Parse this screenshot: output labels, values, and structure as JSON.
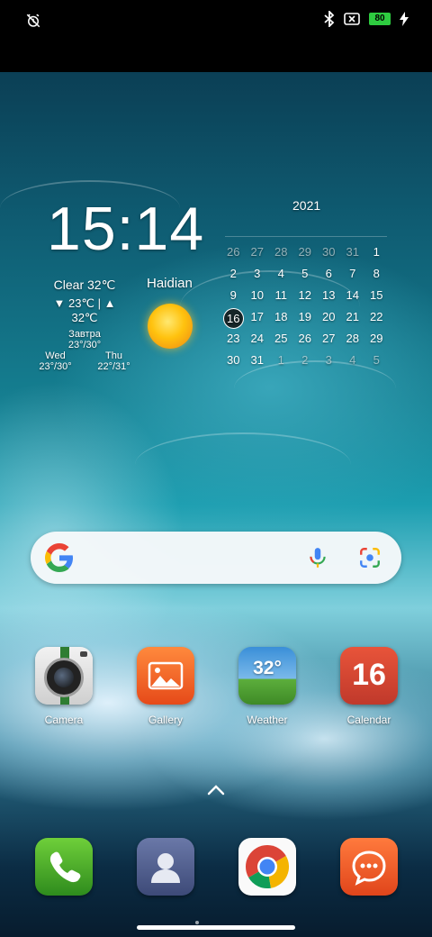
{
  "status_bar": {
    "battery_level": "80",
    "left_icon": "alarm-off-icon",
    "right_icons": [
      "bluetooth-icon",
      "sim-error-icon",
      "battery-icon",
      "charging-icon"
    ]
  },
  "clock_widget": {
    "time": "15:14",
    "weather": {
      "condition": "Clear 32℃",
      "range": "▼ 23℃ | ▲ 32℃",
      "tomorrow_label": "Завтра",
      "tomorrow_range": "23°/30°",
      "forecast": [
        {
          "day": "Wed",
          "range": "23°/30°"
        },
        {
          "day": "Thu",
          "range": "22°/31°"
        }
      ]
    },
    "city": "Haidian",
    "icon": "sun-icon"
  },
  "calendar_widget": {
    "year": "2021",
    "today": "16",
    "days": [
      {
        "d": "26",
        "dim": true
      },
      {
        "d": "27",
        "dim": true
      },
      {
        "d": "28",
        "dim": true
      },
      {
        "d": "29",
        "dim": true
      },
      {
        "d": "30",
        "dim": true
      },
      {
        "d": "31",
        "dim": true
      },
      {
        "d": "1",
        "dim": false
      },
      {
        "d": "2",
        "dim": false
      },
      {
        "d": "3",
        "dim": false
      },
      {
        "d": "4",
        "dim": false
      },
      {
        "d": "5",
        "dim": false
      },
      {
        "d": "6",
        "dim": false
      },
      {
        "d": "7",
        "dim": false
      },
      {
        "d": "8",
        "dim": false
      },
      {
        "d": "9",
        "dim": false
      },
      {
        "d": "10",
        "dim": false
      },
      {
        "d": "11",
        "dim": false
      },
      {
        "d": "12",
        "dim": false
      },
      {
        "d": "13",
        "dim": false
      },
      {
        "d": "14",
        "dim": false
      },
      {
        "d": "15",
        "dim": false
      },
      {
        "d": "16",
        "dim": false
      },
      {
        "d": "17",
        "dim": false
      },
      {
        "d": "18",
        "dim": false
      },
      {
        "d": "19",
        "dim": false
      },
      {
        "d": "20",
        "dim": false
      },
      {
        "d": "21",
        "dim": false
      },
      {
        "d": "22",
        "dim": false
      },
      {
        "d": "23",
        "dim": false
      },
      {
        "d": "24",
        "dim": false
      },
      {
        "d": "25",
        "dim": false
      },
      {
        "d": "26",
        "dim": false
      },
      {
        "d": "27",
        "dim": false
      },
      {
        "d": "28",
        "dim": false
      },
      {
        "d": "29",
        "dim": false
      },
      {
        "d": "30",
        "dim": false
      },
      {
        "d": "31",
        "dim": false
      },
      {
        "d": "1",
        "dim": true
      },
      {
        "d": "2",
        "dim": true
      },
      {
        "d": "3",
        "dim": true
      },
      {
        "d": "4",
        "dim": true
      },
      {
        "d": "5",
        "dim": true
      }
    ]
  },
  "search_bar": {
    "logo": "google-logo-icon",
    "mic": "mic-icon",
    "lens": "lens-icon"
  },
  "apps": [
    {
      "label": "Camera",
      "icon": "camera-icon"
    },
    {
      "label": "Gallery",
      "icon": "gallery-icon"
    },
    {
      "label": "Weather",
      "icon": "weather-icon",
      "icon_text": "32°"
    },
    {
      "label": "Calendar",
      "icon": "calendar-icon",
      "icon_text": "16"
    }
  ],
  "dock": [
    {
      "icon": "phone-icon"
    },
    {
      "icon": "contacts-icon"
    },
    {
      "icon": "chrome-icon"
    },
    {
      "icon": "messages-icon"
    }
  ],
  "colors": {
    "battery_green": "#2ecc40",
    "google_blue": "#4285F4",
    "google_red": "#EA4335",
    "google_yellow": "#FBBC05",
    "google_green": "#34A853"
  }
}
